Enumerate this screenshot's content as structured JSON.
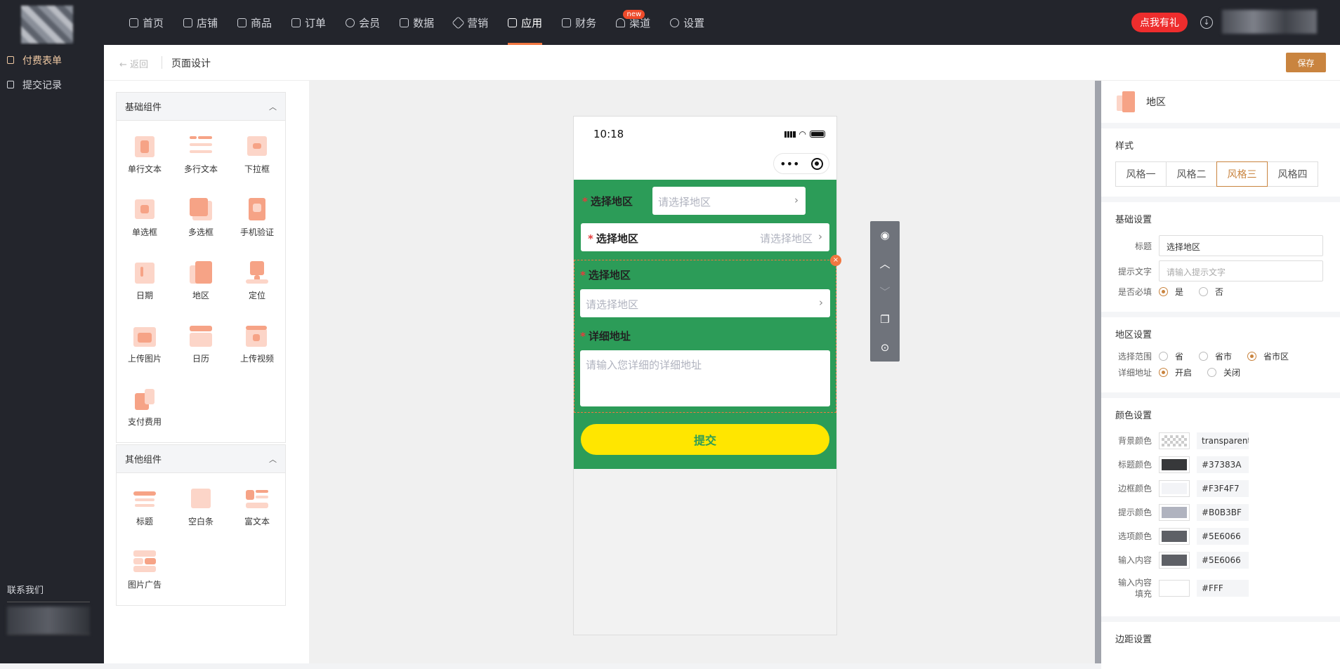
{
  "topbar": {
    "nav": [
      {
        "label": "首页",
        "icon": "home-icon"
      },
      {
        "label": "店铺",
        "icon": "shop-icon"
      },
      {
        "label": "商品",
        "icon": "goods-icon"
      },
      {
        "label": "订单",
        "icon": "order-icon"
      },
      {
        "label": "会员",
        "icon": "member-icon"
      },
      {
        "label": "数据",
        "icon": "chart-icon"
      },
      {
        "label": "营销",
        "icon": "tag-icon"
      },
      {
        "label": "应用",
        "icon": "app-icon",
        "active": true
      },
      {
        "label": "财务",
        "icon": "finance-icon"
      },
      {
        "label": "渠道",
        "icon": "channel-icon",
        "badge": "new"
      },
      {
        "label": "设置",
        "icon": "gear-icon"
      }
    ],
    "gift_button": "点我有礼"
  },
  "sidebar": {
    "items": [
      {
        "label": "付费表单",
        "active": true
      },
      {
        "label": "提交记录"
      }
    ],
    "contact_title": "联系我们"
  },
  "header": {
    "back": "返回",
    "title": "页面设计",
    "save": "保存"
  },
  "palette": {
    "basic": {
      "title": "基础组件",
      "items": [
        "单行文本",
        "多行文本",
        "下拉框",
        "单选框",
        "多选框",
        "手机验证",
        "日期",
        "地区",
        "定位",
        "上传图片",
        "日历",
        "上传视频",
        "支付费用"
      ]
    },
    "other": {
      "title": "其他组件",
      "items": [
        "标题",
        "空白条",
        "富文本",
        "图片广告"
      ]
    }
  },
  "phone": {
    "time": "10:18",
    "field1_label": "选择地区",
    "field1_placeholder": "请选择地区",
    "field2_label": "选择地区",
    "field2_placeholder": "请选择地区",
    "field3_label": "选择地区",
    "field3_placeholder": "请选择地区",
    "address_label": "详细地址",
    "address_placeholder": "请输入您详细的详细地址",
    "submit": "提交",
    "colors": {
      "form_bg": "#2C9C58",
      "submit_bg": "#FFE600"
    }
  },
  "props": {
    "component_name": "地区",
    "style_title": "样式",
    "styles": [
      "风格一",
      "风格二",
      "风格三",
      "风格四"
    ],
    "selected_style": "风格三",
    "basic_title": "基础设置",
    "title_label": "标题",
    "title_value": "选择地区",
    "hint_label": "提示文字",
    "hint_placeholder": "请输入提示文字",
    "required_label": "是否必填",
    "required_yes": "是",
    "required_no": "否",
    "region_title": "地区设置",
    "range_label": "选择范围",
    "range_options": [
      "省",
      "省市",
      "省市区"
    ],
    "range_selected": "省市区",
    "address_label": "详细地址",
    "address_on": "开启",
    "address_off": "关闭",
    "color_title": "颜色设置",
    "colors": [
      {
        "label": "背景颜色",
        "value": "transparent"
      },
      {
        "label": "标题颜色",
        "value": "#37383A"
      },
      {
        "label": "边框颜色",
        "value": "#F3F4F7"
      },
      {
        "label": "提示颜色",
        "value": "#B0B3BF"
      },
      {
        "label": "选项颜色",
        "value": "#5E6066"
      },
      {
        "label": "输入内容",
        "value": "#5E6066"
      },
      {
        "label": "输入内容填充",
        "value": "#FFF"
      }
    ],
    "margin_title": "边距设置"
  }
}
